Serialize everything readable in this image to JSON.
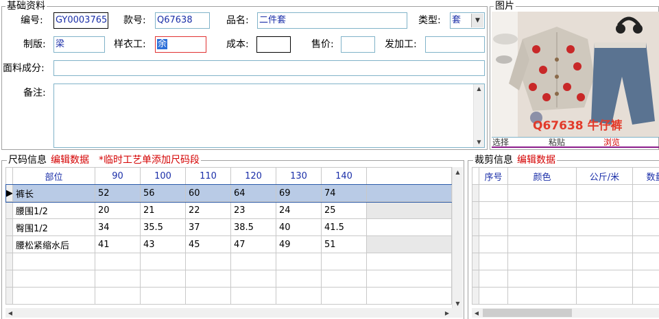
{
  "basic_info": {
    "title": "基础资料",
    "fields": {
      "code_label": "编号:",
      "code_value": "GY0003765",
      "style_label": "款号:",
      "style_value": "Q67638",
      "name_label": "品名:",
      "name_value": "二件套",
      "type_label": "类型:",
      "type_value": "套",
      "plate_label": "制版:",
      "plate_value": "梁",
      "sample_label": "样衣工:",
      "sample_value": "余",
      "cost_label": "成本:",
      "cost_value": "",
      "price_label": "售价:",
      "price_value": "",
      "outsource_label": "发加工:",
      "outsource_value": "",
      "fabric_label": "面料成分:",
      "fabric_value": "",
      "remark_label": "备注:",
      "remark_value": ""
    }
  },
  "photo": {
    "title": "图片",
    "caption": "Q67638 牛仔裤",
    "actions": [
      "选择",
      "粘贴",
      "浏览"
    ]
  },
  "size_info": {
    "title": "尺码信息",
    "edit_link": "编辑数据",
    "note": "*临时工艺单添加尺码段",
    "columns": [
      "部位",
      "90",
      "100",
      "110",
      "120",
      "130",
      "140"
    ],
    "rows": [
      [
        "裤长",
        "52",
        "56",
        "60",
        "64",
        "69",
        "74"
      ],
      [
        "腰围1/2",
        "20",
        "21",
        "22",
        "23",
        "24",
        "25"
      ],
      [
        "臀围1/2",
        "34",
        "35.5",
        "37",
        "38.5",
        "40",
        "41.5"
      ],
      [
        "腰松紧缩水后",
        "41",
        "43",
        "45",
        "47",
        "49",
        "51"
      ]
    ]
  },
  "cut_info": {
    "title": "裁剪信息",
    "edit_link": "编辑数据",
    "columns": [
      "序号",
      "颜色",
      "公斤/米",
      "数量"
    ]
  }
}
